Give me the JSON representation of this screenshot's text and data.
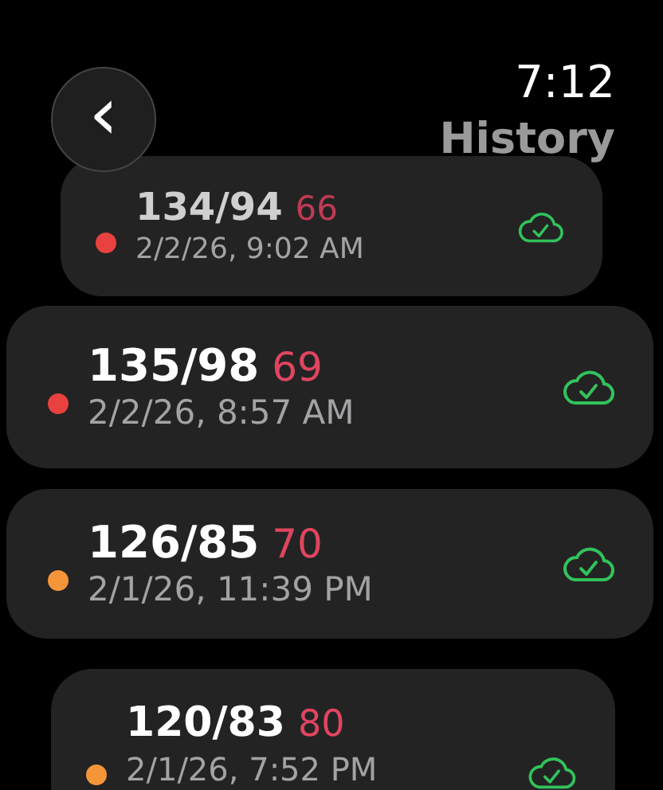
{
  "header": {
    "back": "‹",
    "time": "7:12",
    "title": "History"
  },
  "readings": [
    {
      "bp": "134/94",
      "pulse": "66",
      "date": "2/2/26, 9:02 AM",
      "color": "#e8413f",
      "synced": true
    },
    {
      "bp": "135/98",
      "pulse": "69",
      "date": "2/2/26, 8:57 AM",
      "color": "#e8413f",
      "synced": true
    },
    {
      "bp": "126/85",
      "pulse": "70",
      "date": "2/1/26, 11:39 PM",
      "color": "#f5953a",
      "synced": true
    },
    {
      "bp": "120/83",
      "pulse": "80",
      "date": "2/1/26, 7:52 PM",
      "color": "#f5953a",
      "synced": true
    }
  ]
}
